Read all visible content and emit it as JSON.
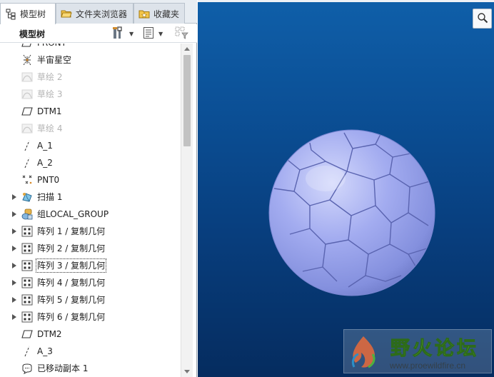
{
  "tabs": [
    {
      "label": "模型树",
      "icon": "model-tree-icon",
      "active": true
    },
    {
      "label": "文件夹浏览器",
      "icon": "folder-browser-icon",
      "active": false
    },
    {
      "label": "收藏夹",
      "icon": "favorites-icon",
      "active": false
    }
  ],
  "tree_panel": {
    "title": "模型树",
    "settings_icon": "tree-settings-icon",
    "show_icon": "tree-show-icon",
    "filter_icon": "tree-filter-icon"
  },
  "tree_items": [
    {
      "label": "FRONT",
      "icon": "datum-plane-icon",
      "dim": false,
      "expandable": false
    },
    {
      "label": "半宙星空",
      "icon": "coordinate-system-icon",
      "dim": false,
      "expandable": false
    },
    {
      "label": "草绘 2",
      "icon": "sketch-icon",
      "dim": true,
      "expandable": false
    },
    {
      "label": "草绘 3",
      "icon": "sketch-icon",
      "dim": true,
      "expandable": false
    },
    {
      "label": "DTM1",
      "icon": "datum-plane-icon",
      "dim": false,
      "expandable": false
    },
    {
      "label": "草绘 4",
      "icon": "sketch-icon",
      "dim": true,
      "expandable": false
    },
    {
      "label": "A_1",
      "icon": "datum-axis-icon",
      "dim": false,
      "expandable": false
    },
    {
      "label": "A_2",
      "icon": "datum-axis-icon",
      "dim": false,
      "expandable": false
    },
    {
      "label": "PNT0",
      "icon": "datum-point-icon",
      "dim": false,
      "expandable": false
    },
    {
      "label": "扫描 1",
      "icon": "sweep-icon",
      "dim": false,
      "expandable": true
    },
    {
      "label": "组LOCAL_GROUP",
      "icon": "group-icon",
      "dim": false,
      "expandable": true
    },
    {
      "label": "阵列 1 / 复制几何",
      "icon": "pattern-icon",
      "dim": false,
      "expandable": true
    },
    {
      "label": "阵列 2 / 复制几何",
      "icon": "pattern-icon",
      "dim": false,
      "expandable": true
    },
    {
      "label": "阵列 3 / 复制几何",
      "icon": "pattern-icon",
      "dim": false,
      "expandable": true,
      "focused": true
    },
    {
      "label": "阵列 4 / 复制几何",
      "icon": "pattern-icon",
      "dim": false,
      "expandable": true
    },
    {
      "label": "阵列 5 / 复制几何",
      "icon": "pattern-icon",
      "dim": false,
      "expandable": true
    },
    {
      "label": "阵列 6 / 复制几何",
      "icon": "pattern-icon",
      "dim": false,
      "expandable": true
    },
    {
      "label": "DTM2",
      "icon": "datum-plane-icon",
      "dim": false,
      "expandable": false
    },
    {
      "label": "A_3",
      "icon": "datum-axis-icon",
      "dim": false,
      "expandable": false
    },
    {
      "label": "已移动副本 1",
      "icon": "moved-copy-icon",
      "dim": false,
      "expandable": false
    }
  ],
  "viewport": {
    "zoom_icon": "zoom-magnifier-icon",
    "model": "soccer-ball-model",
    "background_top": "#0f5fa9",
    "background_bottom": "#052c5f",
    "model_color": "#9ea8ee"
  },
  "watermark": {
    "text": "野火论坛",
    "url": "www.proewildfire.cn",
    "logo_icon": "flame-logo-icon"
  }
}
